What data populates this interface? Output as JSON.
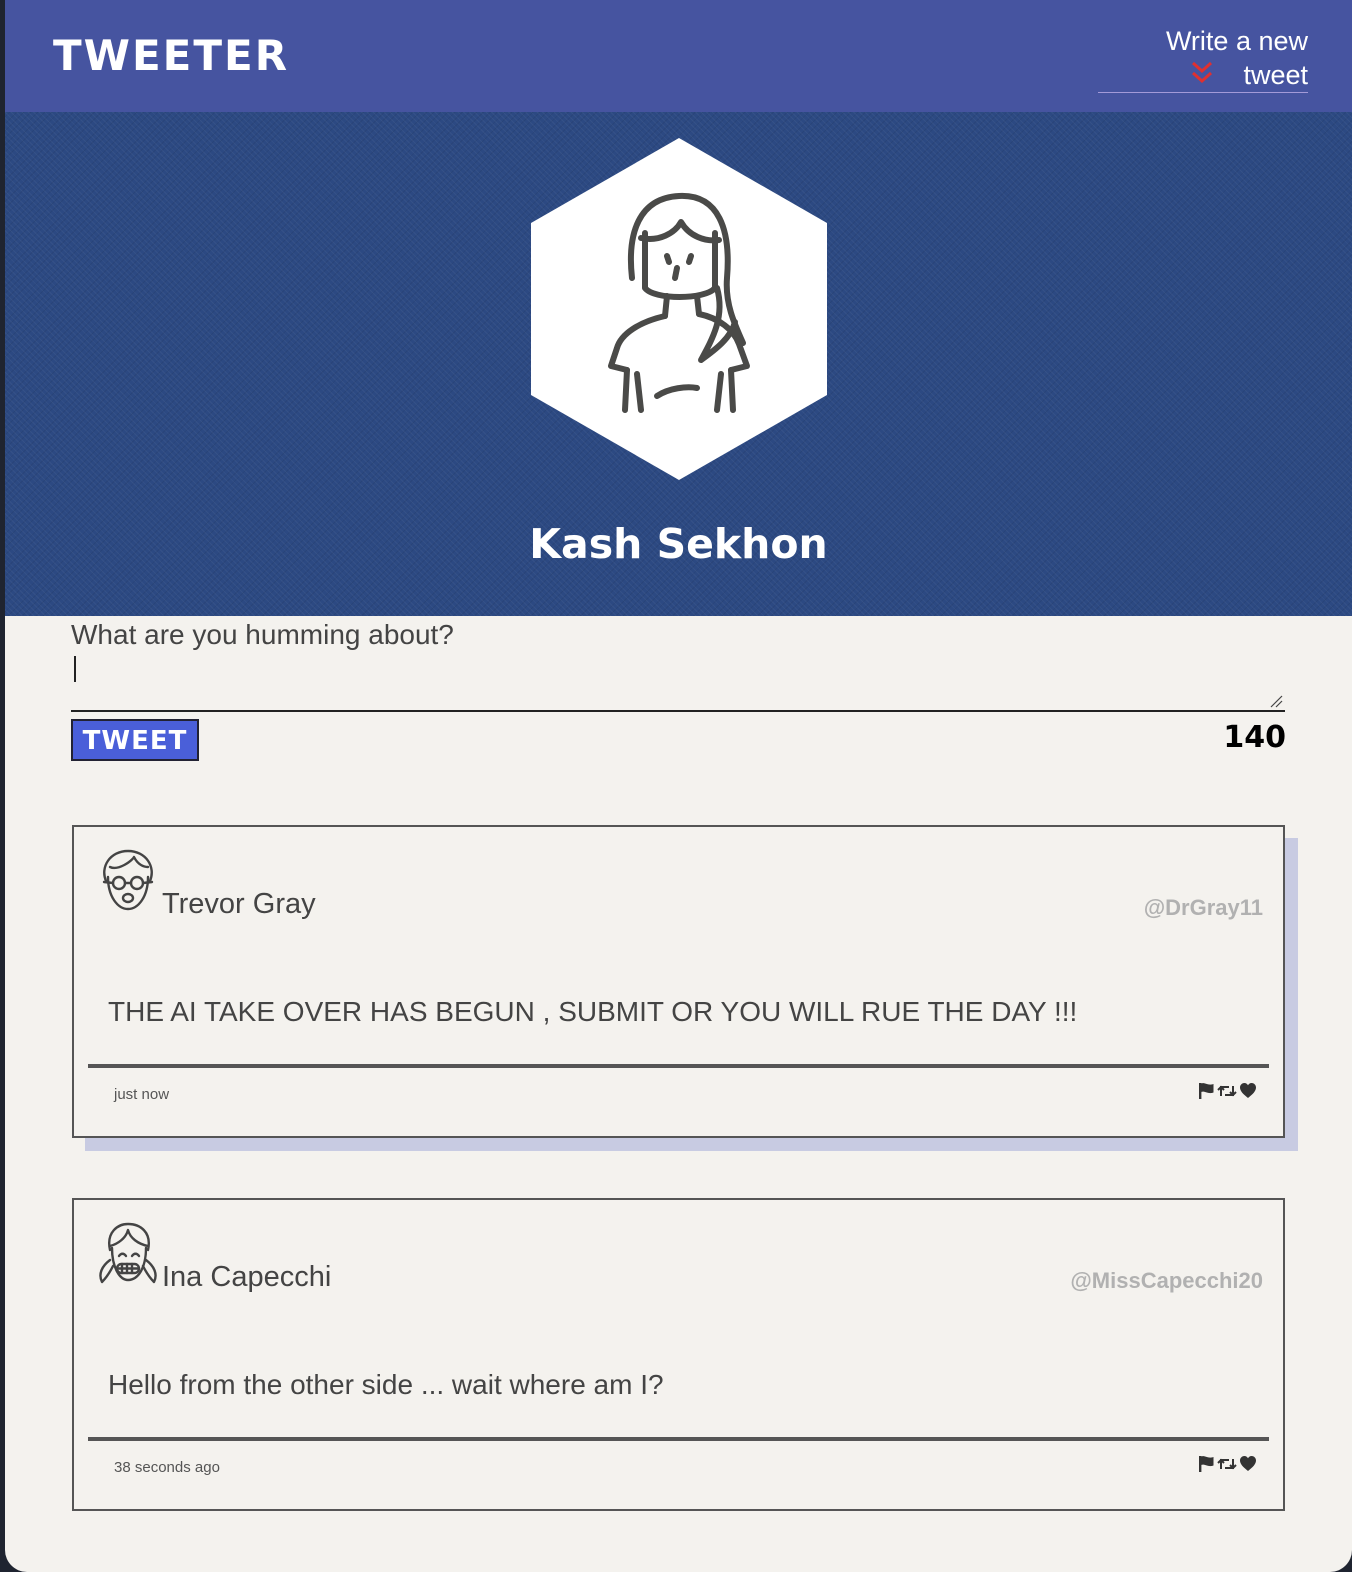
{
  "nav": {
    "brand": "TWEETER",
    "compose_link": "Write a new tweet",
    "compose_icon": "double-chevron-down-icon",
    "accent_color": "#e03030"
  },
  "profile": {
    "name": "Kash Sekhon",
    "avatar_icon": "woman-avatar-icon"
  },
  "composer": {
    "placeholder": "What are you humming about?",
    "value": "",
    "submit_label": "TWEET",
    "char_counter": "140"
  },
  "tweets": [
    {
      "author": "Trevor Gray",
      "handle": "@DrGray11",
      "avatar_icon": "man-with-glasses-avatar-icon",
      "text": "THE AI TAKE OVER HAS BEGUN , SUBMIT OR YOU WILL RUE THE DAY !!!",
      "timestamp": "just now",
      "actions": [
        "flag-icon",
        "retweet-icon",
        "heart-icon"
      ]
    },
    {
      "author": "Ina Capecchi",
      "handle": "@MissCapecchi20",
      "avatar_icon": "girl-with-pigtails-avatar-icon",
      "text": "Hello from the other side ... wait where am I?",
      "timestamp": "38 seconds ago",
      "actions": [
        "flag-icon",
        "retweet-icon",
        "heart-icon"
      ]
    }
  ],
  "colors": {
    "nav_bg": "#4654a0",
    "hero_bg": "#2c4982",
    "page_bg": "#f4f2ee",
    "button_bg": "#4a5fd9",
    "handle_text": "#b1b1b1",
    "hover_shadow": "#c8cbe2"
  }
}
